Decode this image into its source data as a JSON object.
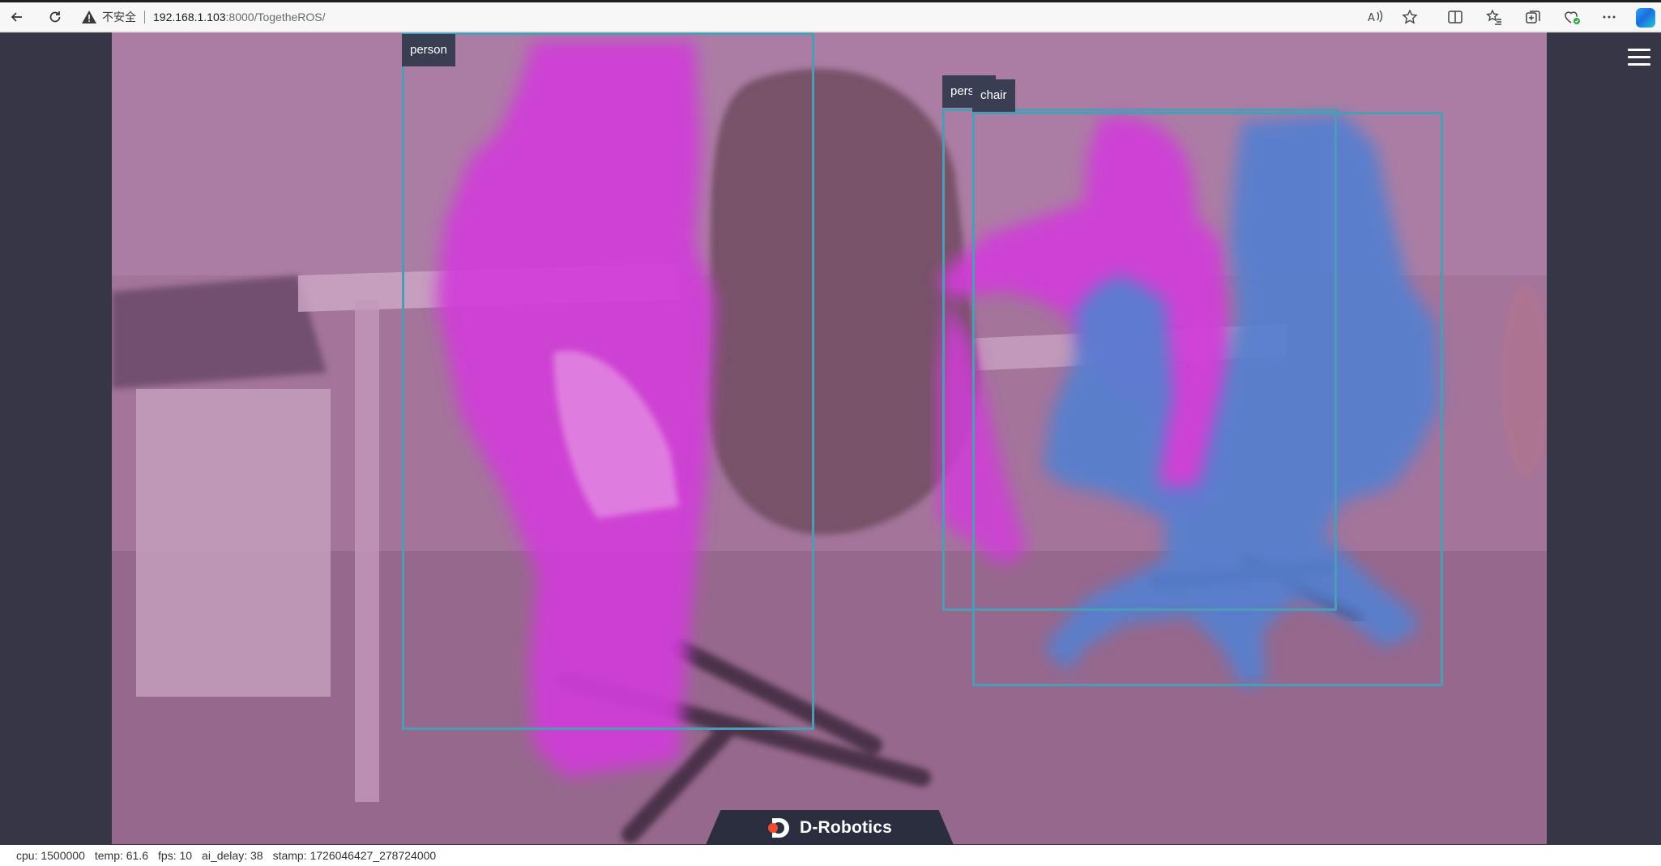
{
  "browser": {
    "security_label": "不安全",
    "url_host": "192.168.1.103",
    "url_path": ":8000/TogetheROS/",
    "toolbar_icons": [
      "back-icon",
      "refresh-icon",
      "read-aloud-icon",
      "favorite-star-icon",
      "split-screen-icon",
      "favorites-icon",
      "collections-icon",
      "browser-essentials-icon",
      "more-icon",
      "copilot-icon"
    ]
  },
  "detections": [
    {
      "label": "person"
    },
    {
      "label": "person"
    },
    {
      "label": "chair"
    }
  ],
  "brand": {
    "name": "D-Robotics"
  },
  "status": {
    "cpu": "cpu: 1500000",
    "temp": "temp: 61.6",
    "fps": "fps: 10",
    "ai_delay": "ai_delay: 38",
    "stamp": "stamp: 1726046427_278724000"
  },
  "colors": {
    "person_mask": "#d63ae0",
    "chair_mask": "#4a86d6",
    "box_stroke": "#4a9db5",
    "scene_tint": "#a3799a",
    "letterbox": "#363647"
  }
}
